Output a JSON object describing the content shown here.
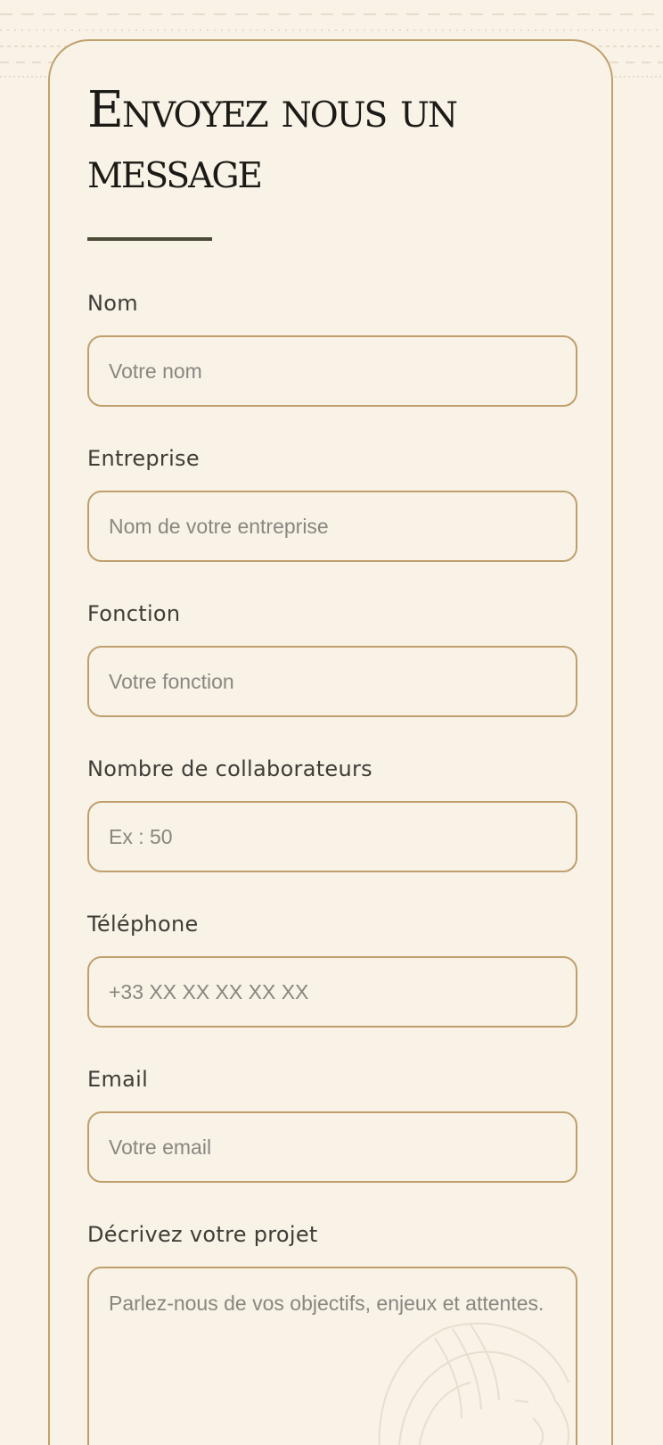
{
  "form": {
    "title_line1": "Envoyez nous un",
    "title_line2": "message",
    "fields": [
      {
        "label": "Nom",
        "placeholder": "Votre nom"
      },
      {
        "label": "Entreprise",
        "placeholder": "Nom de votre entreprise"
      },
      {
        "label": "Fonction",
        "placeholder": "Votre fonction"
      },
      {
        "label": "Nombre de collaborateurs",
        "placeholder": "Ex : 50"
      },
      {
        "label": "Téléphone",
        "placeholder": "+33 XX XX XX XX XX"
      },
      {
        "label": "Email",
        "placeholder": "Votre email"
      }
    ],
    "project": {
      "label": "Décrivez votre projet",
      "placeholder": "Parlez-nous de vos objectifs, enjeux et attentes."
    }
  },
  "colors": {
    "background": "#f8f2e7",
    "border": "#bfa06d",
    "title_rule": "#4b4a35",
    "label_text": "#3f3d37",
    "placeholder_text": "#8a8680"
  }
}
